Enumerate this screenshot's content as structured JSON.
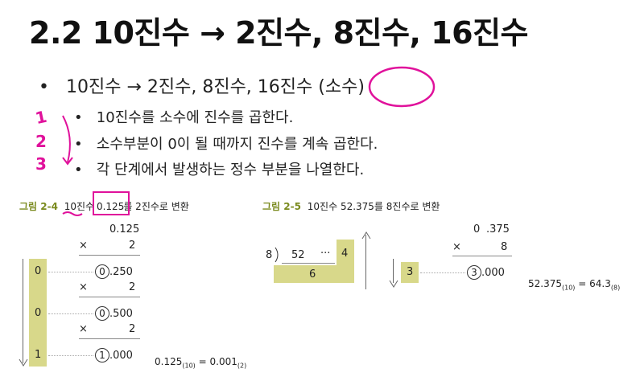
{
  "title": "2.2 10진수 → 2진수, 8진수, 16진수",
  "main_bullet": {
    "bullet": "•",
    "text": "10진수 → 2진수, 8진수, 16진수",
    "paren_open": "(",
    "highlight": "소수",
    "paren_close": ")"
  },
  "sub_bullets": [
    {
      "bullet": "•",
      "text": "10진수를 소수에 진수를 곱한다."
    },
    {
      "bullet": "•",
      "text": "소수부분이 0이 될 때까지 진수를 계속 곱한다."
    },
    {
      "bullet": "•",
      "text": "각 단계에서 발생하는 정수 부분을 나열한다."
    }
  ],
  "handwritten_numbers": [
    "1",
    "2",
    "3"
  ],
  "figure_left": {
    "caption_num": "그림 2-4",
    "caption_pre": "10진수",
    "caption_hl": "0.125",
    "caption_post": "를 2진수로 변환",
    "top_value": "0.125",
    "times": "×",
    "multiplier": "2",
    "rows": [
      {
        "int": "0",
        "frac": ".250"
      },
      {
        "int": "0",
        "frac": ".500"
      },
      {
        "int": "1",
        "frac": ".000"
      }
    ],
    "digits": [
      "0",
      "0",
      "1"
    ],
    "result_lhs": "0.125",
    "result_lhs_sub": "(10)",
    "result_eq": "=",
    "result_rhs": "0.001",
    "result_rhs_sub": "(2)"
  },
  "figure_right": {
    "caption_num": "그림 2-5",
    "caption_text": "10진수 52.375를 8진수로 변환",
    "div_base": "8",
    "div_value": "52",
    "dots": "···",
    "remainder": "4",
    "quotient": "6",
    "frac_top_int": "0",
    "frac_top_frac": ".375",
    "times": "×",
    "multiplier": "8",
    "result_digit": "3",
    "result_int": "3",
    "result_frac": ".000",
    "result_lhs": "52.375",
    "result_lhs_sub": "(10)",
    "result_eq": "=",
    "result_rhs": "64.3",
    "result_rhs_sub": "(8)"
  },
  "colors": {
    "annotation": "#e0119b",
    "figure_fill": "#d8d88a",
    "caption": "#7a8a1e"
  }
}
